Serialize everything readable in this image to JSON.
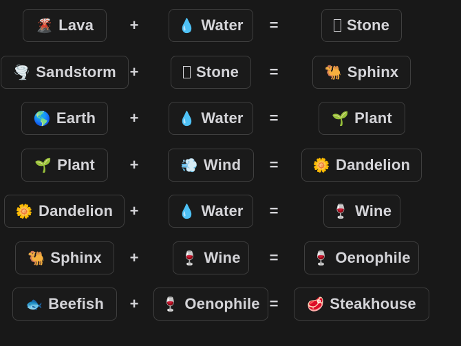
{
  "operators": {
    "plus": "+",
    "equals": "="
  },
  "recipes": [
    {
      "a": {
        "emoji": "🌋",
        "label": "Lava"
      },
      "b": {
        "emoji": "💧",
        "label": "Water"
      },
      "result": {
        "emoji": "",
        "label": "Stone",
        "missing_glyph": true
      }
    },
    {
      "a": {
        "emoji": "🌪️",
        "label": "Sandstorm"
      },
      "b": {
        "emoji": "",
        "label": "Stone",
        "missing_glyph": true
      },
      "result": {
        "emoji": "🐫",
        "label": "Sphinx"
      }
    },
    {
      "a": {
        "emoji": "🌎",
        "label": "Earth"
      },
      "b": {
        "emoji": "💧",
        "label": "Water"
      },
      "result": {
        "emoji": "🌱",
        "label": "Plant"
      }
    },
    {
      "a": {
        "emoji": "🌱",
        "label": "Plant"
      },
      "b": {
        "emoji": "💨",
        "label": "Wind"
      },
      "result": {
        "emoji": "🌼",
        "label": "Dandelion"
      }
    },
    {
      "a": {
        "emoji": "🌼",
        "label": "Dandelion"
      },
      "b": {
        "emoji": "💧",
        "label": "Water"
      },
      "result": {
        "emoji": "🍷",
        "label": "Wine"
      }
    },
    {
      "a": {
        "emoji": "🐫",
        "label": "Sphinx"
      },
      "b": {
        "emoji": "🍷",
        "label": "Wine"
      },
      "result": {
        "emoji": "🍷",
        "label": "Oenophile"
      }
    },
    {
      "a": {
        "emoji": "🐟",
        "label": "Beefish"
      },
      "b": {
        "emoji": "🍷",
        "label": "Oenophile"
      },
      "result": {
        "emoji": "🥩",
        "label": "Steakhouse"
      }
    }
  ]
}
